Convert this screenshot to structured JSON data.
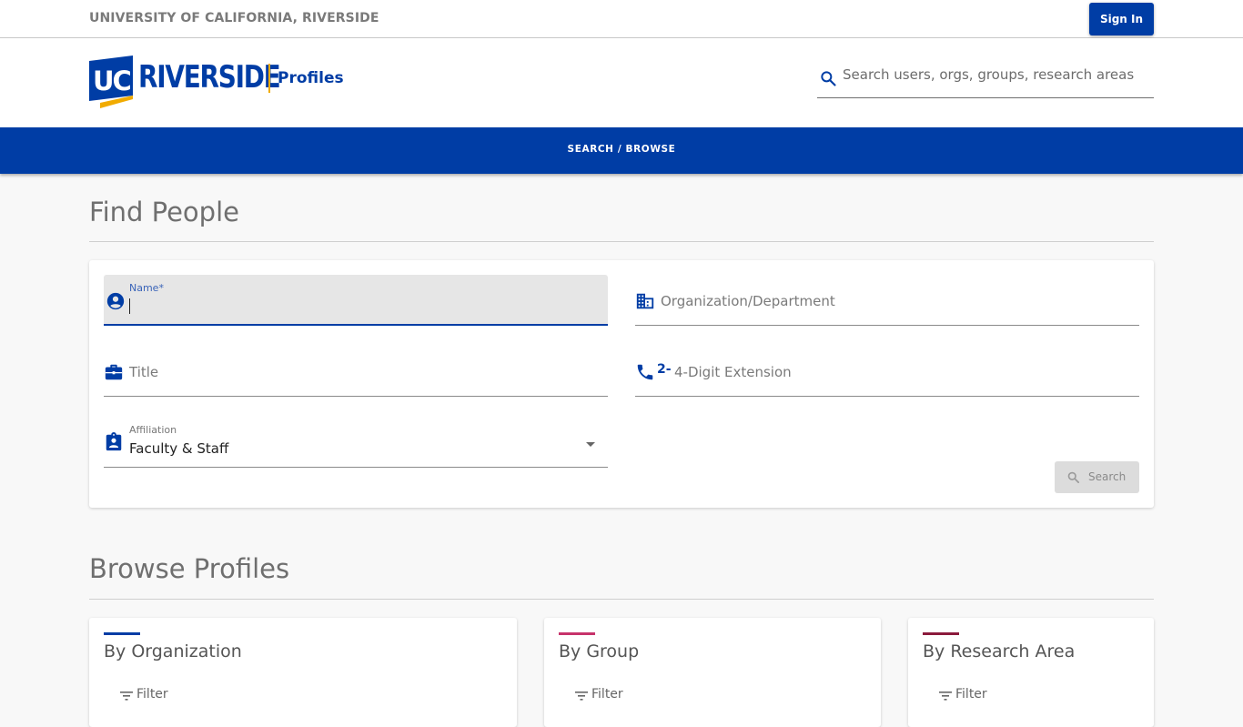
{
  "topbar": {
    "university_name": "UNIVERSITY OF CALIFORNIA, RIVERSIDE",
    "sign_in_label": "Sign In"
  },
  "header": {
    "logo_text": "RIVERSIDE",
    "logo_mark": "UC",
    "logo_subtitle": "Profiles",
    "search": {
      "icon": "search-icon",
      "placeholder": "Search users, orgs, groups, research areas",
      "value": ""
    }
  },
  "nav": {
    "link_label": "SEARCH / BROWSE"
  },
  "find_people": {
    "title": "Find People",
    "fields": {
      "name": {
        "label": "Name*",
        "value": "",
        "icon": "account-circle-icon"
      },
      "organization": {
        "placeholder": "Organization/Department",
        "icon": "domain-icon"
      },
      "title": {
        "placeholder": "Title",
        "icon": "briefcase-icon"
      },
      "extension": {
        "prefix": "2-",
        "placeholder": "4-Digit Extension",
        "icon": "phone-icon"
      },
      "affiliation": {
        "label": "Affiliation",
        "value": "Faculty & Staff",
        "icon": "badge-icon"
      }
    },
    "search_button_label": "Search"
  },
  "browse_profiles": {
    "title": "Browse Profiles",
    "cards": [
      {
        "title": "By Organization",
        "filter_label": "Filter",
        "accent": "#003da5"
      },
      {
        "title": "By Group",
        "filter_label": "Filter",
        "accent": "#c6336b"
      },
      {
        "title": "By Research Area",
        "filter_label": "Filter",
        "accent": "#8b1a3c"
      }
    ]
  },
  "colors": {
    "brand_blue": "#003da5",
    "brand_gold": "#f1ab00"
  }
}
